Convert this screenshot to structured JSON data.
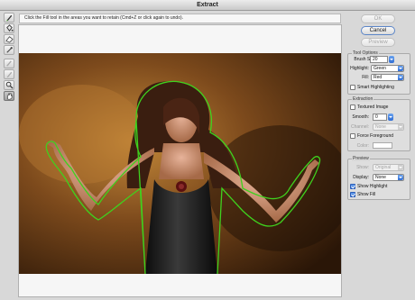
{
  "window": {
    "title": "Extract"
  },
  "instructions": "Click the Fill tool in the areas you want to retain (Cmd+Z or click again to undo).",
  "tools": [
    {
      "name": "edge-highlighter-icon",
      "active": false
    },
    {
      "name": "fill-bucket-icon",
      "active": false
    },
    {
      "name": "eraser-icon",
      "active": false
    },
    {
      "name": "eyedropper-icon",
      "active": false
    },
    {
      "name": "cleanup-tool-icon",
      "active": false
    },
    {
      "name": "edge-touchup-icon",
      "active": false
    },
    {
      "name": "zoom-icon",
      "active": false
    },
    {
      "name": "hand-icon",
      "active": true
    }
  ],
  "buttons": {
    "ok": "OK",
    "cancel": "Cancel",
    "preview": "Preview"
  },
  "tool_options": {
    "title": "Tool Options",
    "brush_size_label": "Brush Size:",
    "brush_size_value": "20",
    "highlight_label": "Highlight:",
    "highlight_value": "Green",
    "fill_label": "Fill:",
    "fill_value": "Red",
    "smart_highlighting_label": "Smart Highlighting",
    "smart_highlighting_checked": false
  },
  "extraction": {
    "title": "Extraction",
    "textured_image_label": "Textured Image",
    "textured_image_checked": false,
    "smooth_label": "Smooth:",
    "smooth_value": "0",
    "channel_label": "Channel:",
    "channel_value": "None",
    "force_foreground_label": "Force Foreground",
    "force_foreground_checked": false,
    "color_label": "Color:"
  },
  "preview": {
    "title": "Preview",
    "show_label": "Show:",
    "show_value": "Original",
    "display_label": "Display:",
    "display_value": "None",
    "show_highlight_label": "Show Highlight",
    "show_highlight_checked": true,
    "show_fill_label": "Show Fill",
    "show_fill_checked": true
  },
  "colors": {
    "highlight_outline": "#3fd11e",
    "accent_blue": "#2f6dd4"
  }
}
